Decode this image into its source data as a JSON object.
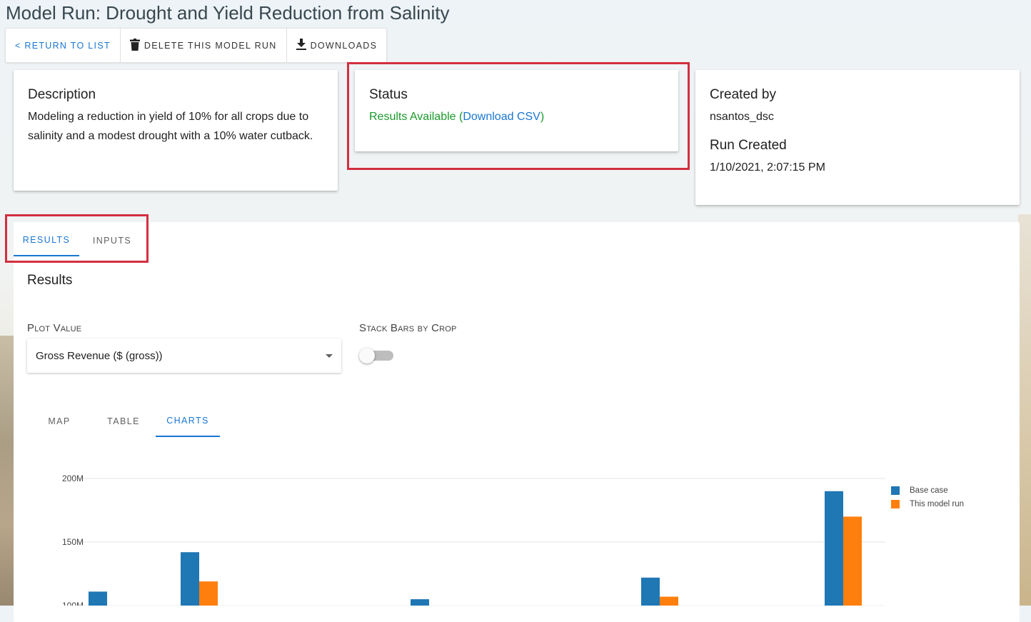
{
  "page": {
    "title": "Model Run: Drought and Yield Reduction from Salinity"
  },
  "toolbar": {
    "return_label": "< RETURN TO LIST",
    "delete_label": "DELETE THIS MODEL RUN",
    "downloads_label": "DOWNLOADS"
  },
  "description_card": {
    "heading": "Description",
    "text": "Modeling a reduction in yield of 10% for all crops due to salinity and a modest drought with a 10% water cutback."
  },
  "status_card": {
    "heading": "Status",
    "status_text": "Results Available",
    "paren_open": " (",
    "link_text": "Download CSV",
    "paren_close": ")"
  },
  "meta_card": {
    "created_by_heading": "Created by",
    "created_by_value": "nsantos_dsc",
    "run_created_heading": "Run Created",
    "run_created_value": "1/10/2021, 2:07:15 PM"
  },
  "main_tabs": [
    {
      "label": "RESULTS",
      "active": true
    },
    {
      "label": "INPUTS",
      "active": false
    }
  ],
  "results": {
    "title": "Results",
    "plot_value_label": "Plot Value",
    "plot_value_selected": "Gross Revenue ($ (gross))",
    "stack_label": "Stack Bars by Crop",
    "stack_on": false
  },
  "view_tabs": [
    {
      "label": "MAP",
      "active": false
    },
    {
      "label": "TABLE",
      "active": false
    },
    {
      "label": "CHARTS",
      "active": true
    }
  ],
  "colors": {
    "base": "#1f77b4",
    "run": "#ff7f0e",
    "accent": "#1976d2",
    "highlight": "#d32f3f"
  },
  "chart_data": {
    "type": "bar",
    "y_ticks": [
      "200M",
      "150M",
      "100M"
    ],
    "ylim": [
      100,
      200
    ],
    "y_unit": "M",
    "legend_position": "top-right",
    "grid": true,
    "series": [
      {
        "name": "Base case",
        "values": [
          111,
          142,
          105,
          122,
          190
        ]
      },
      {
        "name": "This model run",
        "values": [
          null,
          119,
          null,
          107,
          170
        ]
      }
    ]
  }
}
